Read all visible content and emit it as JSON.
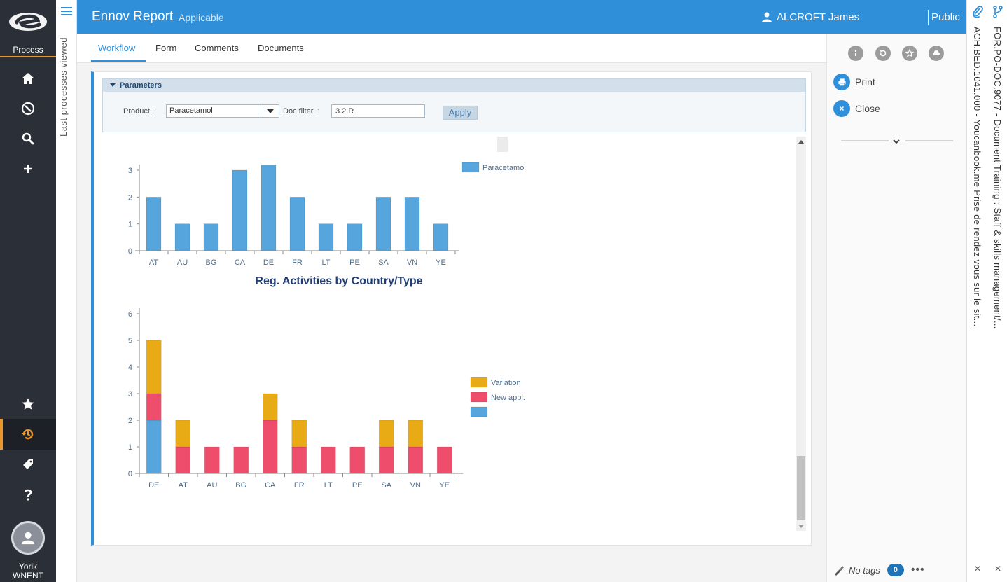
{
  "app": {
    "logo_label": "Process"
  },
  "sidebar": {
    "icons": [
      "home-icon",
      "compass-icon",
      "search-icon",
      "plus-icon"
    ],
    "bottom_icons": [
      "star-icon",
      "history-icon",
      "tag-icon",
      "help-icon"
    ],
    "user_first": "Yorik",
    "user_last": "WNENT",
    "accent_color": "#e8962b"
  },
  "last_processes": {
    "label": "Last processes viewed"
  },
  "header": {
    "title": "Ennov Report",
    "status": "Applicable",
    "user": "ALCROFT James",
    "visibility": "Public",
    "color": "#2f8fd8"
  },
  "tabs": [
    {
      "label": "Workflow",
      "active": true
    },
    {
      "label": "Form",
      "active": false
    },
    {
      "label": "Comments",
      "active": false
    },
    {
      "label": "Documents",
      "active": false
    }
  ],
  "parameters": {
    "title": "Parameters",
    "product_label": "Product",
    "product_value": "Paracetamol",
    "doc_filter_label": "Doc filter",
    "doc_filter_value": "3.2.R",
    "apply_label": "Apply"
  },
  "chart_data": [
    {
      "type": "bar",
      "title": "",
      "categories": [
        "AT",
        "AU",
        "BG",
        "CA",
        "DE",
        "FR",
        "LT",
        "PE",
        "SA",
        "VN",
        "YE"
      ],
      "series": [
        {
          "name": "Paracetamol",
          "values": [
            2,
            1,
            1,
            3,
            3.2,
            2,
            1,
            1,
            2,
            2,
            1
          ],
          "color": "#56a5dd"
        }
      ],
      "ylim": [
        0,
        3
      ],
      "yticks": [
        0,
        1,
        2,
        3
      ],
      "legend": "top-right",
      "grid": false
    },
    {
      "type": "bar",
      "stacked": true,
      "title": "Reg. Activities by Country/Type",
      "categories": [
        "DE",
        "AT",
        "AU",
        "BG",
        "CA",
        "FR",
        "LT",
        "PE",
        "SA",
        "VN",
        "YE"
      ],
      "series": [
        {
          "name": "",
          "values": [
            2,
            0,
            0,
            0,
            0,
            0,
            0,
            0,
            0,
            0,
            0
          ],
          "color": "#56a5dd"
        },
        {
          "name": "New appl.",
          "values": [
            1,
            1,
            1,
            1,
            2,
            1,
            1,
            1,
            1,
            1,
            1
          ],
          "color": "#ee4e6c"
        },
        {
          "name": "Variation",
          "values": [
            2,
            1,
            0,
            0,
            1,
            1,
            0,
            0,
            1,
            1,
            0
          ],
          "color": "#e8ab16"
        }
      ],
      "ylim": [
        0,
        6
      ],
      "yticks": [
        0,
        1,
        2,
        3,
        4,
        5,
        6
      ],
      "legend": "right",
      "grid": false
    }
  ],
  "right_panel": {
    "icons": [
      "info-icon",
      "refresh-icon",
      "star-icon",
      "cloud-icon"
    ],
    "print_label": "Print",
    "close_label": "Close",
    "tags_label": "No tags",
    "tags_count": "0",
    "more_label": "•••"
  },
  "doc_tabs": [
    {
      "label": "ACH.BED.1041.000 - Youcanbook.me Prise de rendez vous sur le sit..."
    },
    {
      "label": "FOR.PO-DOC.9077 - Document Training : Staff & skills management/..."
    }
  ]
}
